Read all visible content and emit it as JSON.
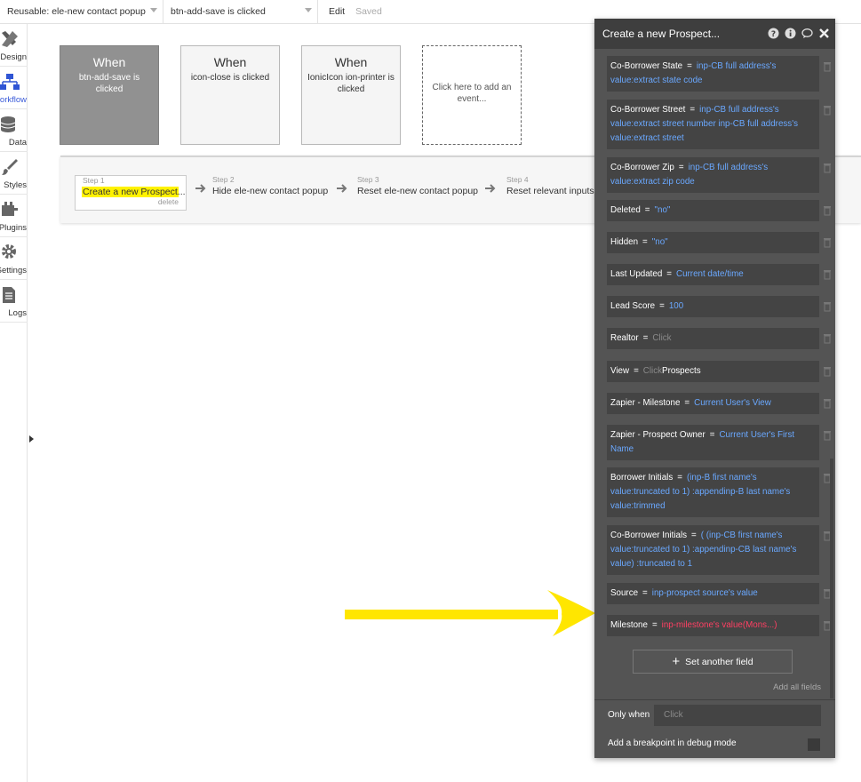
{
  "topbar": {
    "reusable_select": "Reusable: ele-new contact popup",
    "event_select": "btn-add-save is clicked",
    "edit": "Edit",
    "saved": "Saved"
  },
  "sidebar": {
    "items": [
      {
        "label": "Design",
        "icon": "design-icon"
      },
      {
        "label": "Workflow",
        "icon": "workflow-icon"
      },
      {
        "label": "Data",
        "icon": "database-icon"
      },
      {
        "label": "Styles",
        "icon": "brush-icon"
      },
      {
        "label": "Plugins",
        "icon": "plugin-icon"
      },
      {
        "label": "Settings",
        "icon": "gear-icon"
      },
      {
        "label": "Logs",
        "icon": "document-icon"
      }
    ]
  },
  "events": [
    {
      "when": "When",
      "text": "btn-add-save is clicked"
    },
    {
      "when": "When",
      "text": "icon-close is clicked"
    },
    {
      "when": "When",
      "text": "IonicIcon ion-printer is clicked"
    },
    {
      "text": "Click here to add an event..."
    }
  ],
  "steps": [
    {
      "num": "Step 1",
      "name": "Create a new Prospect...",
      "delete": "delete"
    },
    {
      "num": "Step 2",
      "name": "Hide ele-new contact popup"
    },
    {
      "num": "Step 3",
      "name": "Reset ele-new contact popup"
    },
    {
      "num": "Step 4",
      "name": "Reset relevant inputs"
    }
  ],
  "panel": {
    "title": "Create a new Prospect...",
    "fields": [
      {
        "name": "Co-Borrower State",
        "value": "inp-CB full address's value:extract state code"
      },
      {
        "name": "Co-Borrower Street",
        "value": "inp-CB full address's value:extract street number inp-CB full address's value:extract street"
      },
      {
        "name": "Co-Borrower Zip",
        "value": "inp-CB full address's value:extract zip code"
      },
      {
        "name": "Deleted",
        "value": "\"no\""
      },
      {
        "name": "Hidden",
        "value": "\"no\""
      },
      {
        "name": "Last Updated",
        "value": "Current date/time"
      },
      {
        "name": "Lead Score",
        "value": "100"
      },
      {
        "name": "Realtor",
        "value": "Click"
      },
      {
        "name": "View",
        "value": "Click",
        "value2": "Prospects"
      },
      {
        "name": "Zapier - Milestone",
        "value": "Current User's View"
      },
      {
        "name": "Zapier - Prospect Owner",
        "value": "Current User's First Name"
      },
      {
        "name": "Borrower Initials",
        "value": "(inp-B first name's value:truncated to 1) :appendinp-B last name's value:trimmed"
      },
      {
        "name": "Co-Borrower Initials",
        "value": "( (inp-CB first name's value:truncated to 1) :appendinp-CB last name's value) :truncated to 1"
      },
      {
        "name": "Source",
        "value": "inp-prospect source's value"
      },
      {
        "name": "Milestone",
        "value": "inp-milestone's value(Mons...)"
      }
    ],
    "set_another_field": "Set another field",
    "add_all_fields": "Add all fields",
    "only_when": "Only when",
    "only_when_placeholder": "Click",
    "breakpoint": "Add a breakpoint in debug mode"
  },
  "colors": {
    "panel_bg": "#545454",
    "field_bg": "#444444",
    "expression_blue": "#6aa8ff",
    "error_red": "#ff3f63",
    "highlight_yellow": "#fff200",
    "annotation_arrow": "#ffe600"
  }
}
